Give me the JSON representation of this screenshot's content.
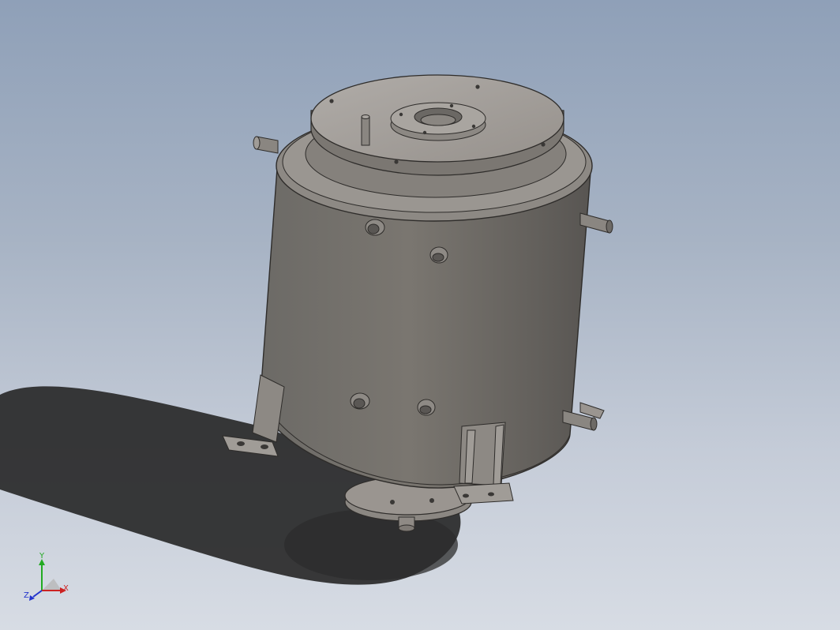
{
  "viewport": {
    "background_top": "#8fa0b8",
    "background_bottom": "#d7dce4"
  },
  "model": {
    "body_color": "#6e6b67",
    "top_color": "#a8a39f",
    "edge_color": "#2e2c2a"
  },
  "triad": {
    "x_label": "X",
    "y_label": "Y",
    "z_label": "Z",
    "x_color": "#cc2222",
    "y_color": "#22aa22",
    "z_color": "#2233cc"
  }
}
